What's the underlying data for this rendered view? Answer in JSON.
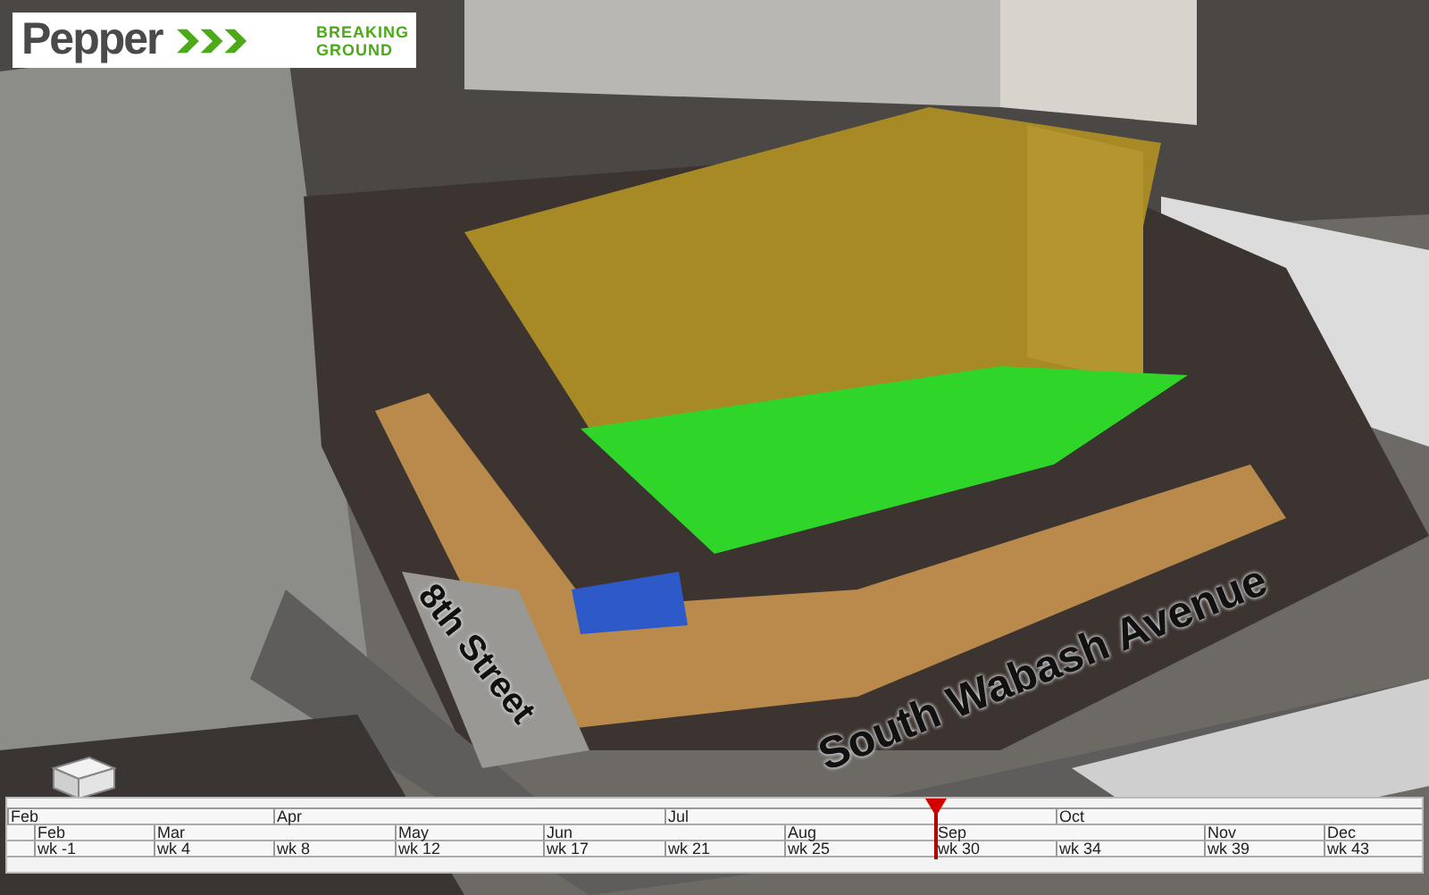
{
  "logo": {
    "name": "Pepper",
    "tagline_lines": [
      "BREAKING",
      "GROUND"
    ]
  },
  "viewport": {
    "kind": "picture",
    "street_labels": [
      "8th Street",
      "South Wabash Avenue"
    ]
  },
  "timeline": {
    "quarters": [
      {
        "label": "Feb"
      },
      {
        "label": "Apr"
      },
      {
        "label": "Jul"
      },
      {
        "label": "Oct"
      }
    ],
    "columns": [
      {
        "month": "Feb",
        "week": "wk -1",
        "selected": false
      },
      {
        "month": "Mar",
        "week": "wk 4",
        "selected": false
      },
      {
        "week": "wk 8",
        "selected": false
      },
      {
        "month": "May",
        "week": "wk 12",
        "selected": false
      },
      {
        "month": "Jun",
        "week": "wk 17",
        "selected": false
      },
      {
        "week": "wk 21",
        "selected": false
      },
      {
        "month": "Aug",
        "week": "wk 25",
        "selected": false
      },
      {
        "month": "Sep",
        "week": "wk 30",
        "selected": true
      },
      {
        "week": "wk 34",
        "selected": false
      },
      {
        "month": "Nov",
        "week": "wk 39",
        "selected": false
      },
      {
        "month": "Dec",
        "week": "wk 43",
        "selected": false
      }
    ]
  }
}
